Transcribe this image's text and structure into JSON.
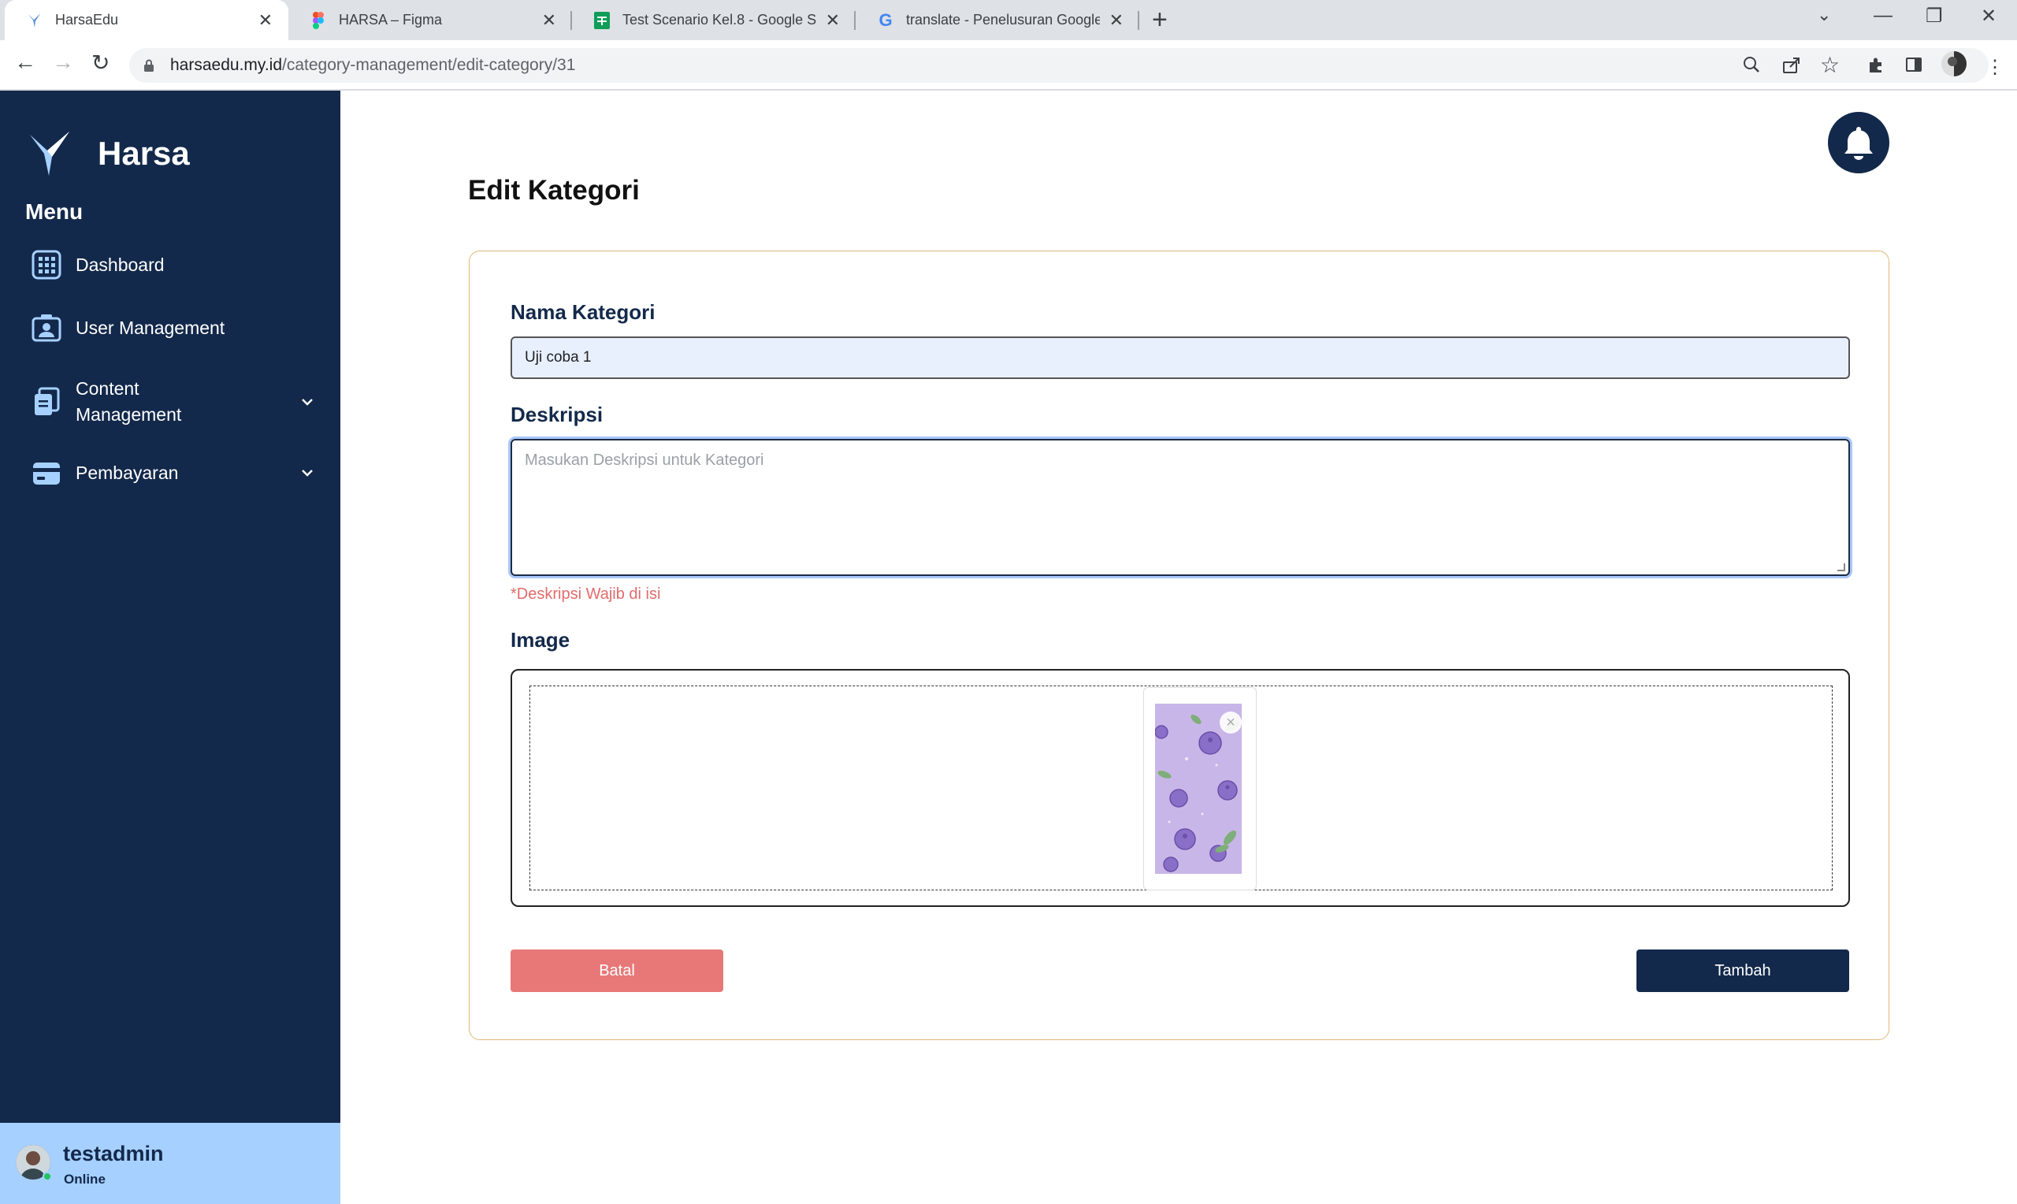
{
  "browser": {
    "tabs": [
      {
        "title": "HarsaEdu",
        "favicon": "harsa-bird-icon"
      },
      {
        "title": "HARSA – Figma",
        "favicon": "figma-icon"
      },
      {
        "title": "Test Scenario Kel.8 - Google Spr",
        "favicon": "sheets-icon"
      },
      {
        "title": "translate - Penelusuran Google",
        "favicon": "google-icon"
      }
    ],
    "url_host": "harsaedu.my.id",
    "url_path": "/category-management/edit-category/31"
  },
  "sidebar": {
    "brand": "Harsa",
    "menu_title": "Menu",
    "items": [
      {
        "label": "Dashboard",
        "icon": "grid-icon"
      },
      {
        "label": "User Management",
        "icon": "user-card-icon"
      },
      {
        "label": "Content\nManagement",
        "icon": "documents-icon",
        "expandable": true
      },
      {
        "label": "Pembayaran",
        "icon": "wallet-icon",
        "expandable": true
      }
    ],
    "user": {
      "name": "testadmin",
      "status": "Online"
    }
  },
  "main": {
    "title": "Edit Kategori",
    "form": {
      "name_label": "Nama Kategori",
      "name_value": "Uji coba 1",
      "desc_label": "Deskripsi",
      "desc_placeholder": "Masukan Deskripsi untuk Kategori",
      "desc_error": "*Deskripsi Wajib di isi",
      "image_label": "Image",
      "cancel_label": "Batal",
      "submit_label": "Tambah"
    }
  },
  "colors": {
    "sidebar_bg": "#13294b",
    "user_bar_bg": "#a6d0ff",
    "cancel_bg": "#e87878",
    "submit_bg": "#13294b",
    "card_border": "#e0b878",
    "error_text": "#e26b6b"
  }
}
